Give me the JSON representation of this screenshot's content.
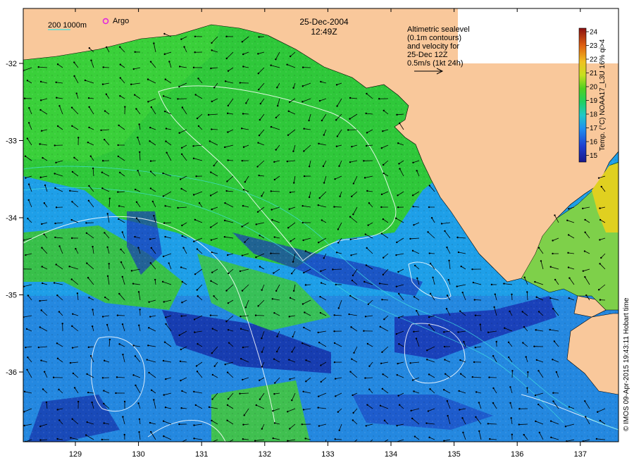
{
  "header": {
    "date": "25-Dec-2004",
    "time": "12:49Z"
  },
  "scale_legend": {
    "isobaths": "200  1000m",
    "argo": "Argo"
  },
  "altimetry_note": {
    "line1": "Altimetric sealevel",
    "line2": "(0.1m contours)",
    "line3": "and velocity for",
    "line4": "25-Dec 12Z",
    "line5": "0.5m/s (1kt 24h)"
  },
  "colorbar": {
    "title": "Temp. (°C) NOAA17_L3U 16% qi>4",
    "ticks": [
      "24",
      "23",
      "22",
      "21",
      "20",
      "19",
      "18",
      "17",
      "16",
      "15"
    ],
    "min": 15,
    "max": 24
  },
  "credit": "© IMOS 09-Apr-2015 19:43:11 Hobart time",
  "axes": {
    "lon_ticks": [
      "129",
      "130",
      "131",
      "132",
      "133",
      "134",
      "135",
      "136",
      "137"
    ],
    "lat_ticks": [
      "-32",
      "-33",
      "-34",
      "-35",
      "-36"
    ]
  },
  "colors": {
    "land": "#f9c89b",
    "warm": "#f0e020",
    "green": "#2fd12f",
    "cool": "#1fa0f0",
    "cold": "#10208f"
  }
}
